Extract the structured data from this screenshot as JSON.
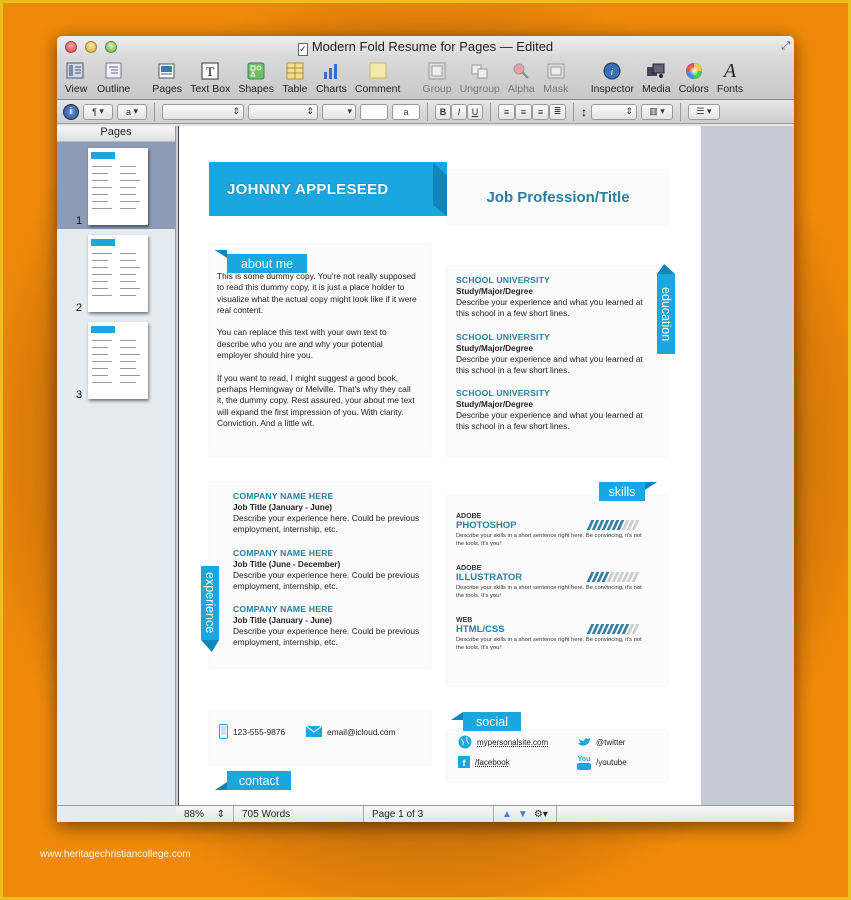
{
  "window": {
    "title": "Modern Fold Resume for Pages — Edited"
  },
  "toolbar": {
    "items": [
      {
        "label": "View",
        "icon": "view-icon"
      },
      {
        "label": "Outline",
        "icon": "outline-icon"
      },
      {
        "label": "Pages",
        "icon": "pages-icon"
      },
      {
        "label": "Text Box",
        "icon": "text-box-icon"
      },
      {
        "label": "Shapes",
        "icon": "shapes-icon"
      },
      {
        "label": "Table",
        "icon": "table-icon"
      },
      {
        "label": "Charts",
        "icon": "charts-icon"
      },
      {
        "label": "Comment",
        "icon": "comment-icon"
      },
      {
        "label": "Group",
        "icon": "group-icon"
      },
      {
        "label": "Ungroup",
        "icon": "ungroup-icon"
      },
      {
        "label": "Alpha",
        "icon": "alpha-icon"
      },
      {
        "label": "Mask",
        "icon": "mask-icon"
      },
      {
        "label": "Inspector",
        "icon": "inspector-icon"
      },
      {
        "label": "Media",
        "icon": "media-icon"
      },
      {
        "label": "Colors",
        "icon": "colors-icon"
      },
      {
        "label": "Fonts",
        "icon": "fonts-icon"
      }
    ]
  },
  "formatbar": {
    "paragraph_style": "¶",
    "char_style": "a",
    "text_color_sample": "a",
    "bold": "B",
    "italic": "I",
    "underline": "U"
  },
  "sidebar": {
    "header": "Pages",
    "pages": [
      {
        "number": "1",
        "selected": true
      },
      {
        "number": "2",
        "selected": false
      },
      {
        "number": "3",
        "selected": false
      }
    ]
  },
  "statusbar": {
    "zoom": "88%",
    "words": "705 Words",
    "page": "Page 1 of 3"
  },
  "resume": {
    "name": "JOHNNY APPLESEED",
    "profession": "Job Profession/Title",
    "about": {
      "label": "about me",
      "paragraphs": [
        "This is some dummy copy. You're not really supposed to read this dummy copy, it is just a place holder to visualize what the actual copy might look like if it were real content.",
        "You can replace this text with your own text to describe who you are and why your potential employer should hire you.",
        "If you want to read, I might suggest a good book, perhaps Hemingway or Melville. That's why they call it, the dummy copy. Rest assured, your about me text will expand the first impression of you. With clarity. Conviction. And a little wit."
      ]
    },
    "education": {
      "label": "education",
      "entries": [
        {
          "school": "SCHOOL UNIVERSITY",
          "degree": "Study/Major/Degree",
          "desc": "Describe your experience and what you learned at this school in a few short lines."
        },
        {
          "school": "SCHOOL UNIVERSITY",
          "degree": "Study/Major/Degree",
          "desc": "Describe your experience and what you learned at this school in a few short lines."
        },
        {
          "school": "SCHOOL UNIVERSITY",
          "degree": "Study/Major/Degree",
          "desc": "Describe your experience and what you learned at this school in a few short lines."
        }
      ]
    },
    "experience": {
      "label": "experience",
      "entries": [
        {
          "company": "COMPANY NAME HERE",
          "title": "Job Title (January - June)",
          "desc": "Describe your experience here. Could be previous employment, internship, etc."
        },
        {
          "company": "COMPANY NAME HERE",
          "title": "Job Title (June - December)",
          "desc": "Describe your experience here. Could be previous employment, internship, etc."
        },
        {
          "company": "COMPANY NAME HERE",
          "title": "Job Title (January - June)",
          "desc": "Describe your experience here. Could be previous employment, internship, etc."
        }
      ]
    },
    "skills": {
      "label": "skills",
      "entries": [
        {
          "category": "ADOBE",
          "name": "PHOTOSHOP",
          "level": 7,
          "max": 10,
          "desc": "Describe your skills in a short sentence right here. Be convincing, it's not the tools. It's you!"
        },
        {
          "category": "ADOBE",
          "name": "ILLUSTRATOR",
          "level": 4,
          "max": 10,
          "desc": "Describe your skills in a short sentence right here. Be convincing, it's not the tools. It's you!"
        },
        {
          "category": "WEB",
          "name": "HTML/CSS",
          "level": 8,
          "max": 10,
          "desc": "Describe your skills in a short sentence right here. Be convincing, it's not the tools. It's you!"
        }
      ]
    },
    "contact": {
      "label": "contact",
      "phone": "123-555-9876",
      "email": "email@icloud.com"
    },
    "social": {
      "label": "social",
      "website": "mypersonalsite.com",
      "twitter": "@twitter",
      "facebook": "/facebook",
      "youtube": "/youtube"
    }
  },
  "colors": {
    "accent": "#1aa7e0",
    "heading": "#2a7ea0",
    "background": "#f08a0a"
  },
  "watermark": "www.heritagechristiancollege.com"
}
